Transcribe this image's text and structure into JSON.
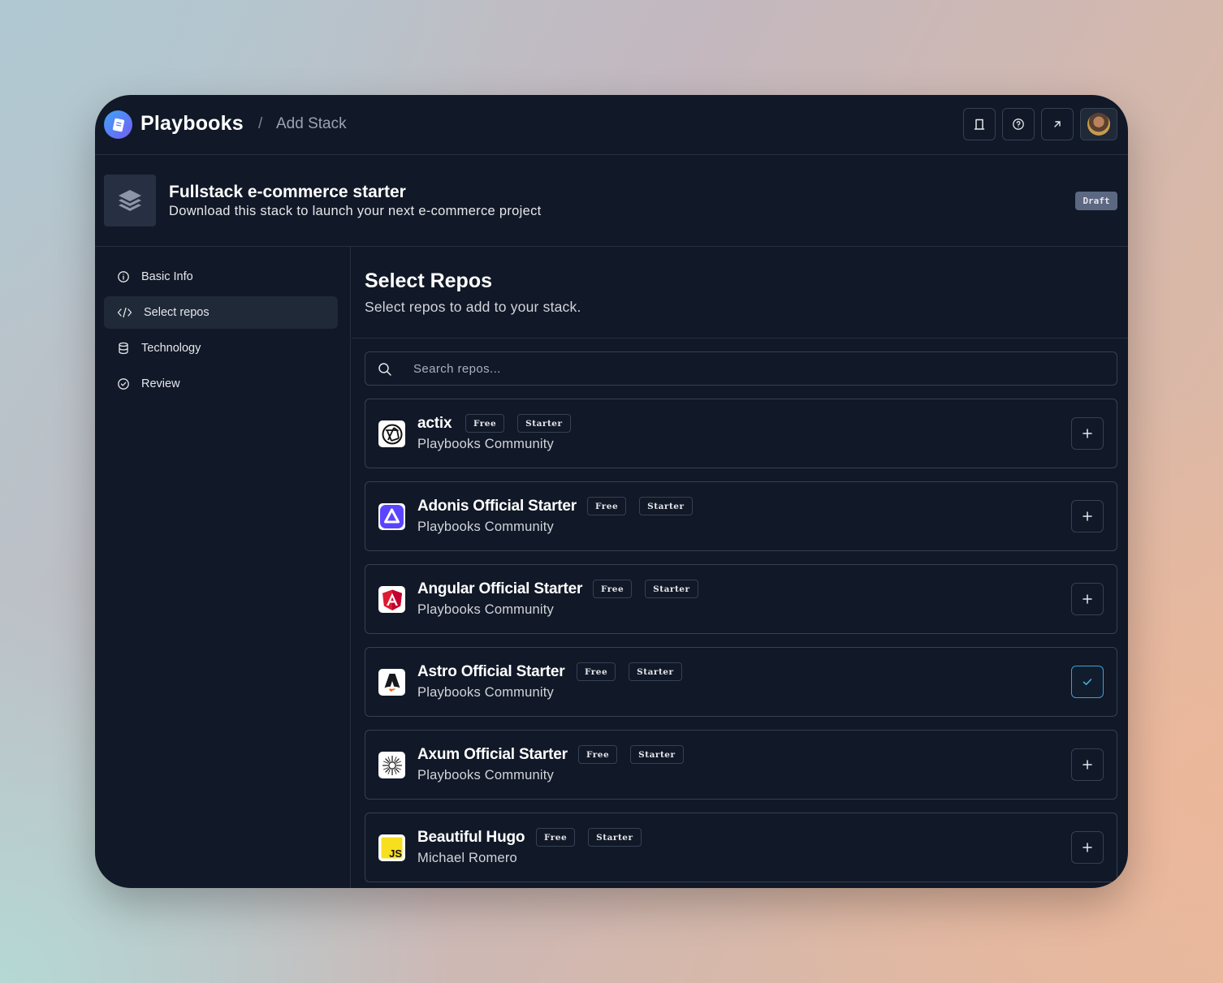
{
  "header": {
    "brand": "Playbooks",
    "separator": "/",
    "breadcrumb": "Add Stack",
    "buttons": [
      {
        "name": "bookmark-button",
        "icon": "bookmark-icon"
      },
      {
        "name": "help-button",
        "icon": "help-circle-icon"
      },
      {
        "name": "open-external-button",
        "icon": "arrow-up-right-icon"
      }
    ],
    "avatar": "user-avatar"
  },
  "stack": {
    "title": "Fullstack e-commerce starter",
    "subtitle": "Download this stack to launch your next e-commerce project",
    "status": "Draft"
  },
  "sidebar": {
    "items": [
      {
        "label": "Basic Info",
        "icon": "info-icon",
        "active": false
      },
      {
        "label": "Select repos",
        "icon": "code-icon",
        "active": true
      },
      {
        "label": "Technology",
        "icon": "database-icon",
        "active": false
      },
      {
        "label": "Review",
        "icon": "check-circle-icon",
        "active": false
      }
    ]
  },
  "main": {
    "title": "Select Repos",
    "subtitle": "Select repos to add to your stack.",
    "search": {
      "placeholder": "Search repos...",
      "value": ""
    },
    "repos": [
      {
        "name": "actix",
        "owner": "Playbooks Community",
        "tags": [
          "Free",
          "Starter"
        ],
        "selected": false,
        "logo": "actix-logo"
      },
      {
        "name": "Adonis Official Starter",
        "owner": "Playbooks Community",
        "tags": [
          "Free",
          "Starter"
        ],
        "selected": false,
        "logo": "adonis-logo"
      },
      {
        "name": "Angular Official Starter",
        "owner": "Playbooks Community",
        "tags": [
          "Free",
          "Starter"
        ],
        "selected": false,
        "logo": "angular-logo"
      },
      {
        "name": "Astro Official Starter",
        "owner": "Playbooks Community",
        "tags": [
          "Free",
          "Starter"
        ],
        "selected": true,
        "logo": "astro-logo"
      },
      {
        "name": "Axum Official Starter",
        "owner": "Playbooks Community",
        "tags": [
          "Free",
          "Starter"
        ],
        "selected": false,
        "logo": "axum-logo"
      },
      {
        "name": "Beautiful Hugo",
        "owner": "Michael Romero",
        "tags": [
          "Free",
          "Starter"
        ],
        "selected": false,
        "logo": "js-logo",
        "logo_text": "JS"
      }
    ]
  },
  "colors": {
    "window_bg": "#111827",
    "border": "#263042",
    "accent_selected": "#3b9fd6",
    "draft_badge": "#5c6881"
  }
}
